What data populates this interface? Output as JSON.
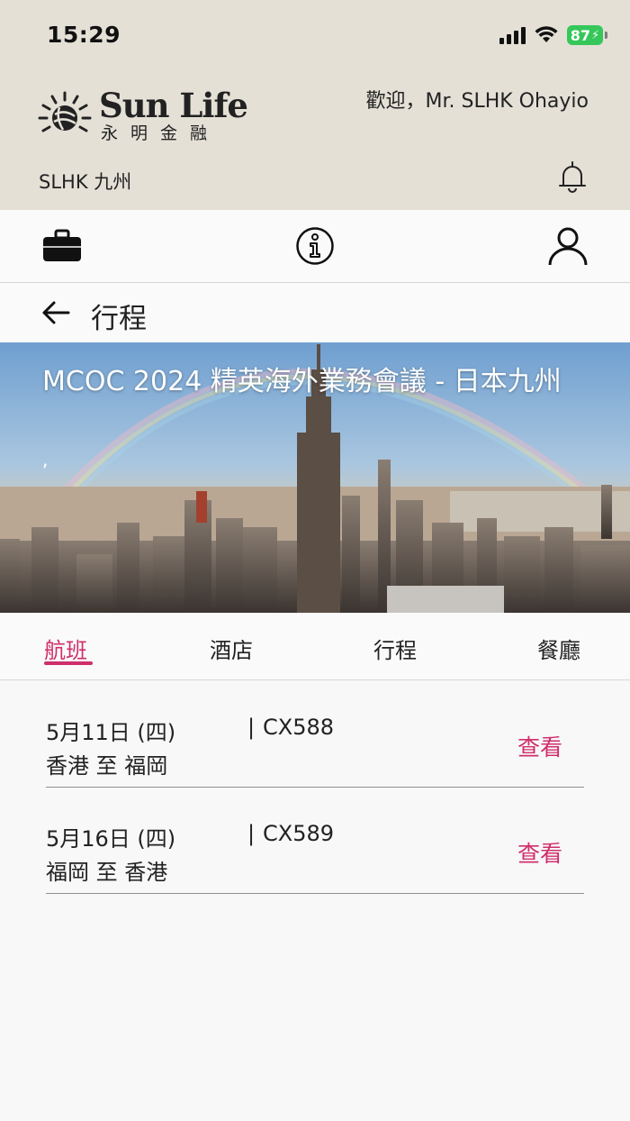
{
  "status_bar": {
    "time": "15:29",
    "battery": "87"
  },
  "header": {
    "logo_en": "Sun Life",
    "logo_zh": "永明金融",
    "welcome": "歡迎，Mr. SLHK Ohayio",
    "location": "SLHK 九州"
  },
  "toolbar": {
    "icons": [
      "briefcase-icon",
      "info-icon",
      "person-icon"
    ]
  },
  "page": {
    "title": "行程"
  },
  "hero": {
    "title": "MCOC 2024 精英海外業務會議 - 日本九州",
    "subtitle": ","
  },
  "tabs": [
    {
      "label": "航班",
      "active": true
    },
    {
      "label": "酒店",
      "active": false
    },
    {
      "label": "行程",
      "active": false
    },
    {
      "label": "餐廳",
      "active": false
    }
  ],
  "flights": [
    {
      "date": "5月11日 (四)",
      "code": "CX588",
      "route": "香港 至 福岡",
      "action": "查看"
    },
    {
      "date": "5月16日 (四)",
      "code": "CX589",
      "route": "福岡 至 香港",
      "action": "查看"
    }
  ],
  "colors": {
    "accent": "#cf2f6b",
    "header_bg": "#e4e0d6"
  }
}
